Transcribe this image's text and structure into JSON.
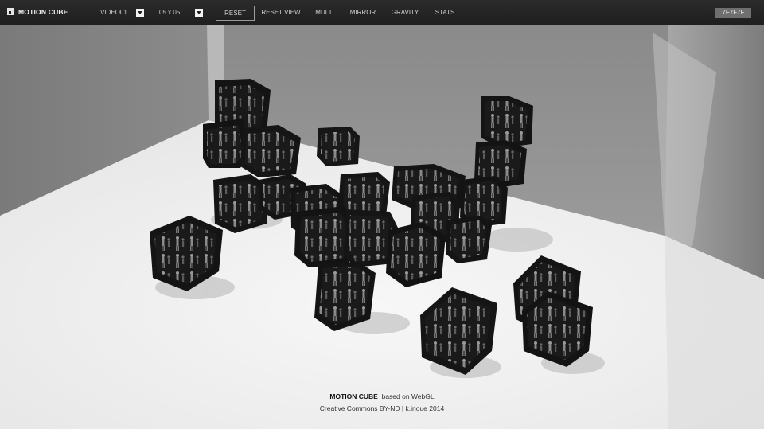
{
  "app": {
    "title": "MOTION CUBE"
  },
  "toolbar": {
    "video_select": "VIDEO01",
    "grid_select": "05 x 05",
    "buttons": [
      "RESET",
      "RESET VIEW",
      "MULTI",
      "MIRROR",
      "GRAVITY",
      "STATS"
    ],
    "active_button": "RESET",
    "color_value": "7F7F7F"
  },
  "footer": {
    "name": "MOTION CUBE",
    "based_on": "based on WebGL",
    "license": "Creative Commons BY-ND | k.inoue 2014"
  },
  "colors": {
    "toolbar_bg": "#232323",
    "room_bg": "#7f7f7f",
    "floor": "#f2f2f2",
    "cube": "#141414"
  }
}
